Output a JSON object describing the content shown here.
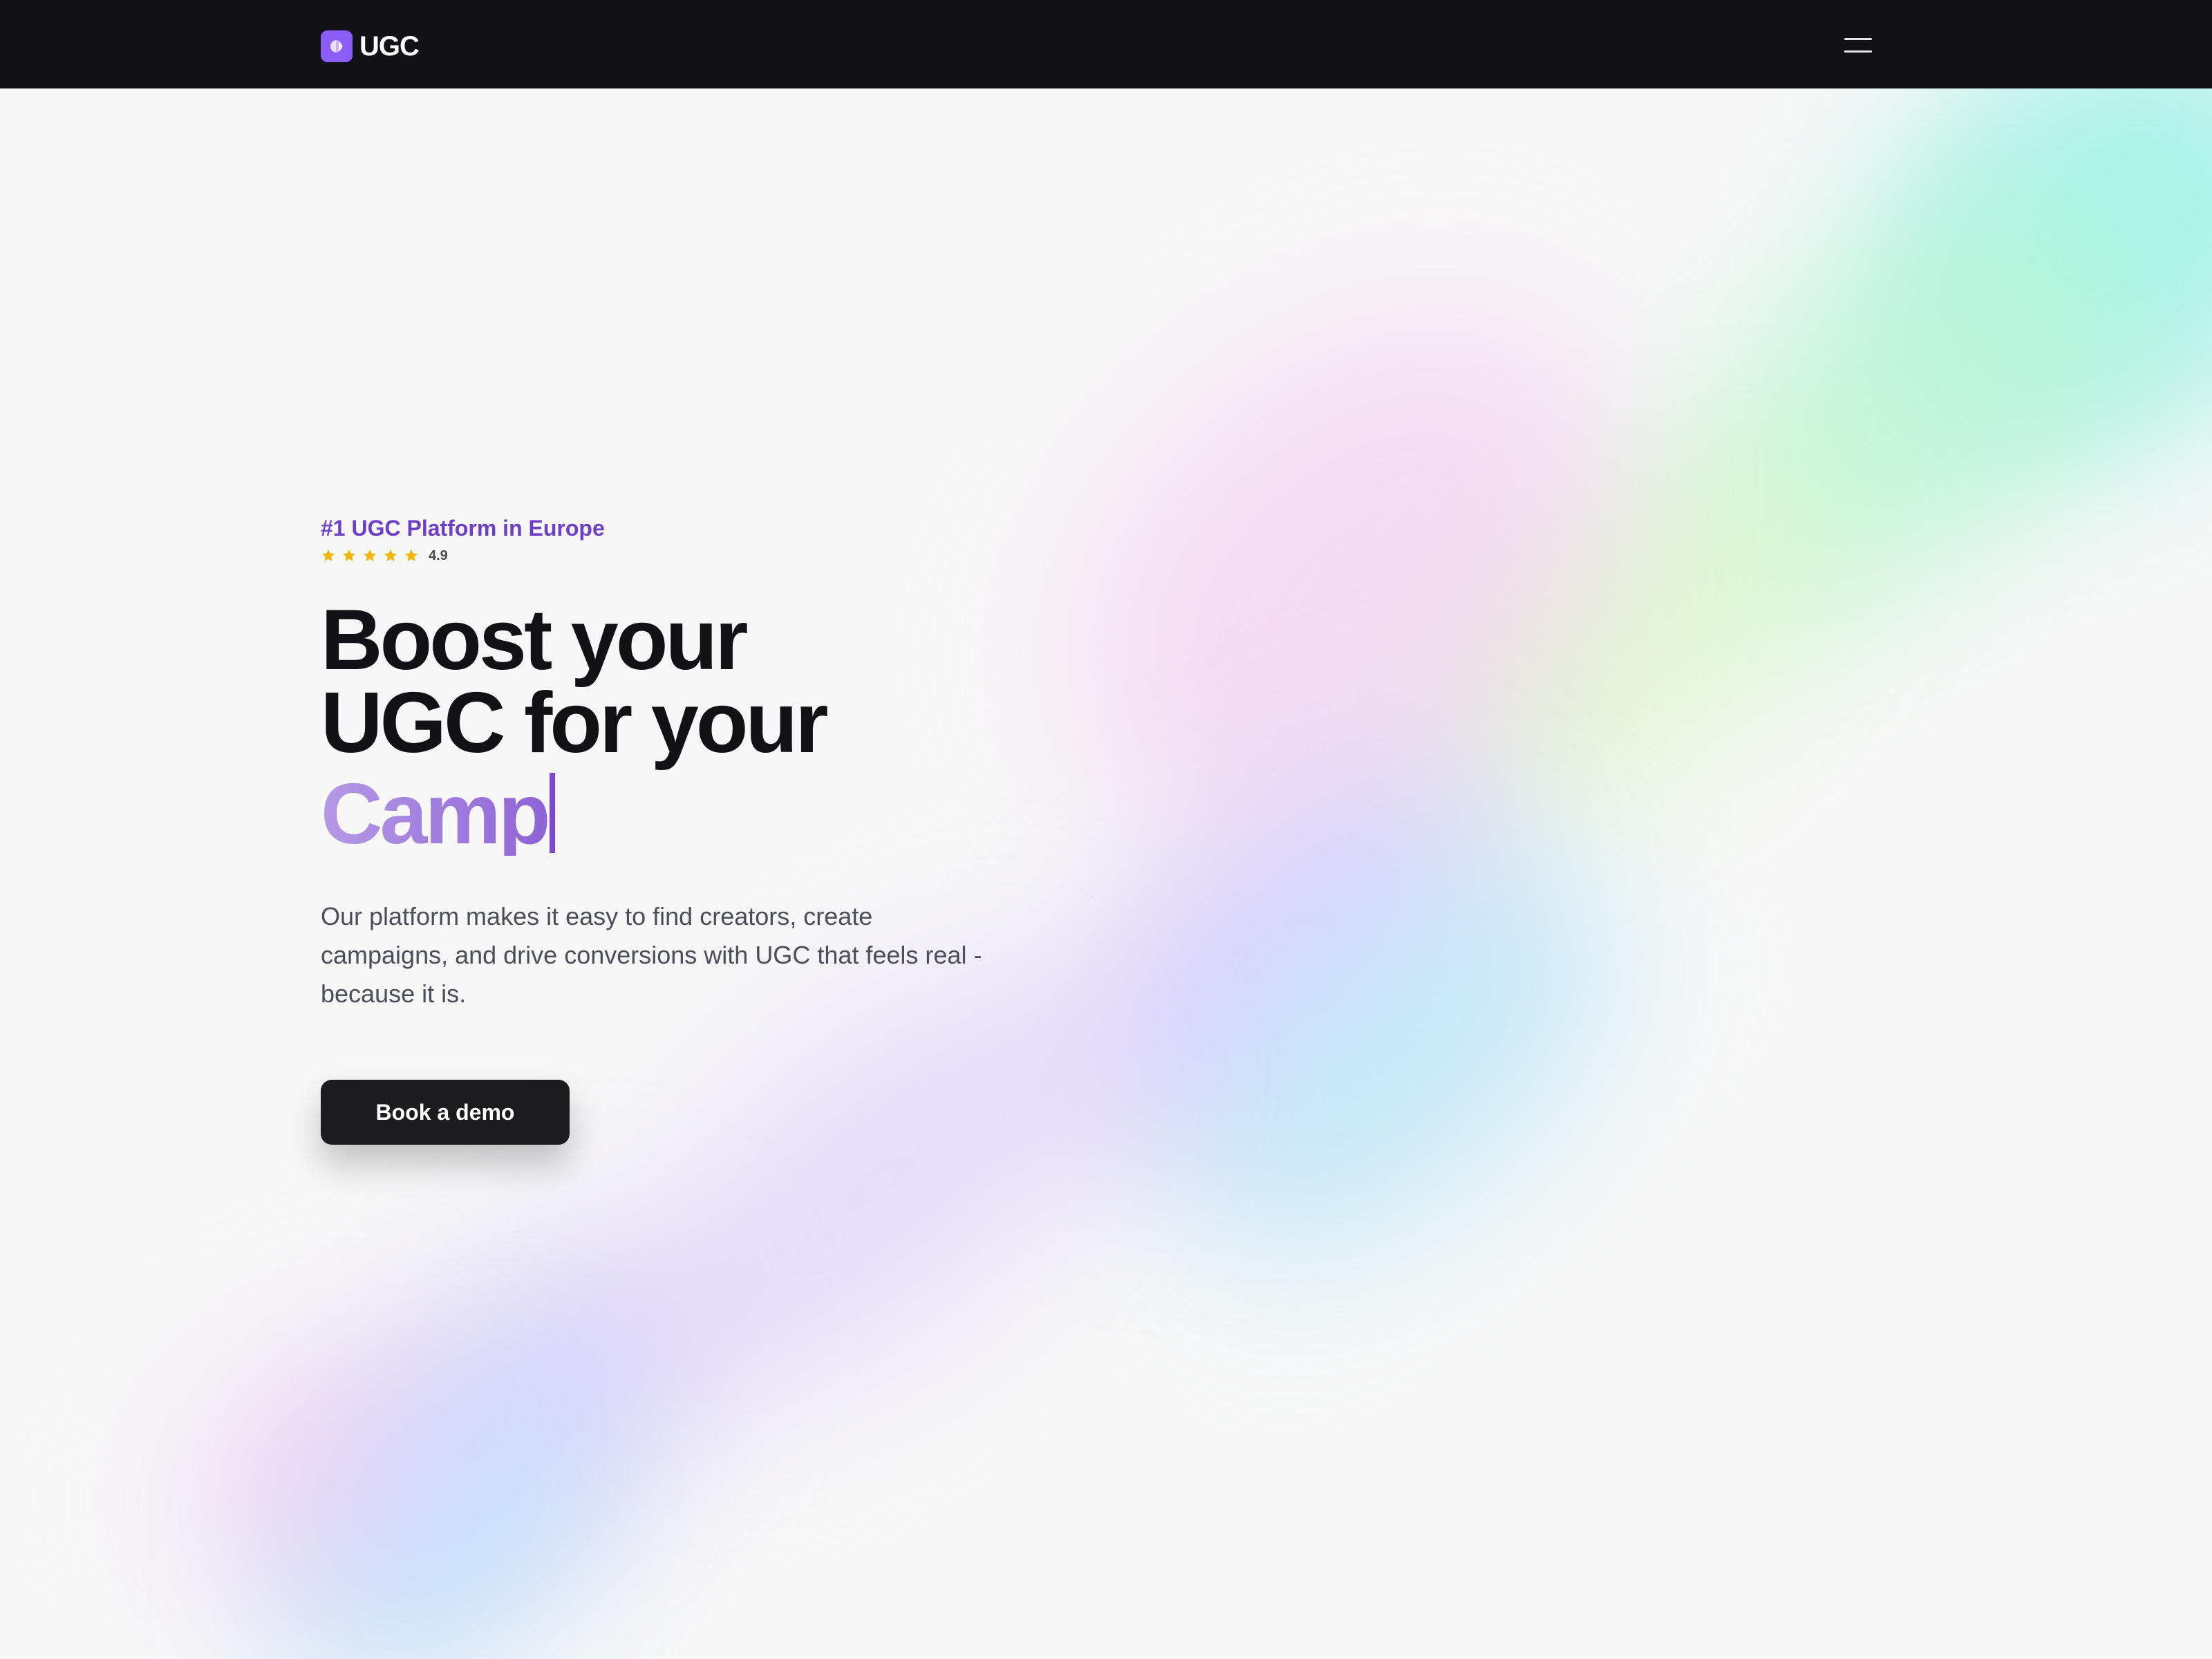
{
  "navbar": {
    "logo_text": "UGC",
    "logo_icon": "ugc-logo-mark",
    "menu_icon": "hamburger-menu-icon",
    "background": "#111116"
  },
  "hero": {
    "eyebrow": "#1 UGC Platform in Europe",
    "rating": {
      "stars": 5,
      "value": "4.9",
      "star_color": "#f5b400"
    },
    "headline_line_1": "Boost your",
    "headline_line_2": "UGC for your",
    "headline_typed": "Camp",
    "subtitle": "Our platform makes it easy to find creators, create campaigns, and drive conversions with UGC that feels real - because it is.",
    "cta_label": "Book a demo"
  },
  "colors": {
    "accent": "#6d3fc9",
    "typed_gradient_start": "#b59ae6",
    "typed_gradient_end": "#8f63d6",
    "cta_background": "#1c1c1f",
    "page_background": "#f7f7f7"
  }
}
